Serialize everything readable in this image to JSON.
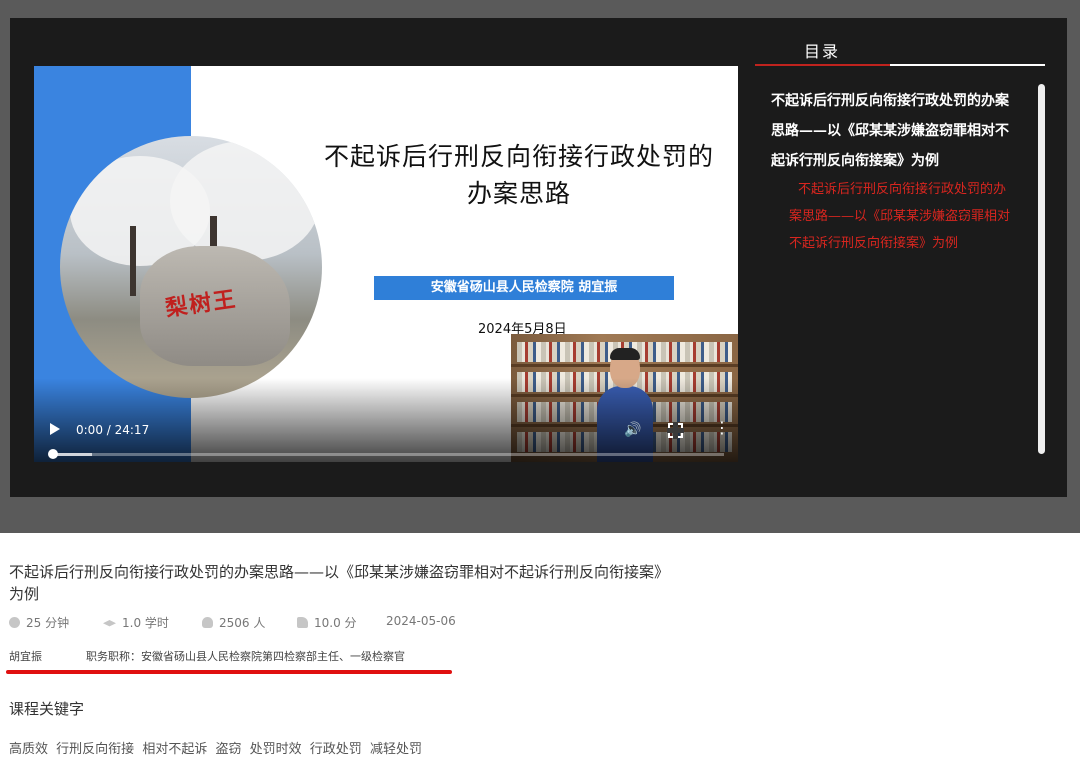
{
  "video": {
    "slide_title_line1": "不起诉后行刑反向衔接行政处罚的",
    "slide_title_line2": "办案思路",
    "slide_banner": "安徽省砀山县人民检察院  胡宜振",
    "slide_date": "2024年5月8日",
    "rock_inscription": "梨树王",
    "time": "0:00 / 24:17",
    "progress_fraction": 0.0,
    "buffered_fraction": 0.06,
    "icons": {
      "play": "play-icon",
      "volume": "volume-icon",
      "fullscreen": "fullscreen-icon",
      "more": "more-options-icon"
    }
  },
  "toc": {
    "title": "目录",
    "chapter": "不起诉后行刑反向衔接行政处罚的办案思路——以《邱某某涉嫌盗窃罪相对不起诉行刑反向衔接案》为例",
    "item": "不起诉后行刑反向衔接行政处罚的办案思路——以《邱某某涉嫌盗窃罪相对不起诉行刑反向衔接案》为例"
  },
  "course": {
    "title": "不起诉后行刑反向衔接行政处罚的办案思路——以《邱某某涉嫌盗窃罪相对不起诉行刑反向衔接案》为例",
    "meta": [
      {
        "icon": "clock-icon",
        "text": "25 分钟"
      },
      {
        "icon": "graduation-cap-icon",
        "text": "1.0 学时"
      },
      {
        "icon": "user-icon",
        "text": "2506 人"
      },
      {
        "icon": "thumbs-up-icon",
        "text": "10.0 分"
      },
      {
        "icon": "",
        "text": "2024-05-06"
      }
    ],
    "teacher_name": "胡宜振",
    "teacher_title": "职务职称：安徽省砀山县人民检察院第四检察部主任、一级检察官",
    "keywords_heading": "课程关键字",
    "keywords": [
      "高质效",
      "行刑反向衔接",
      "相对不起诉",
      "盗窃",
      "处罚时效",
      "行政处罚",
      "减轻处罚"
    ]
  },
  "colors": {
    "accent_red": "#c0231e",
    "toc_item_red": "#d8261f",
    "underline_red": "#e01010",
    "slide_blue": "#3a84e0"
  }
}
